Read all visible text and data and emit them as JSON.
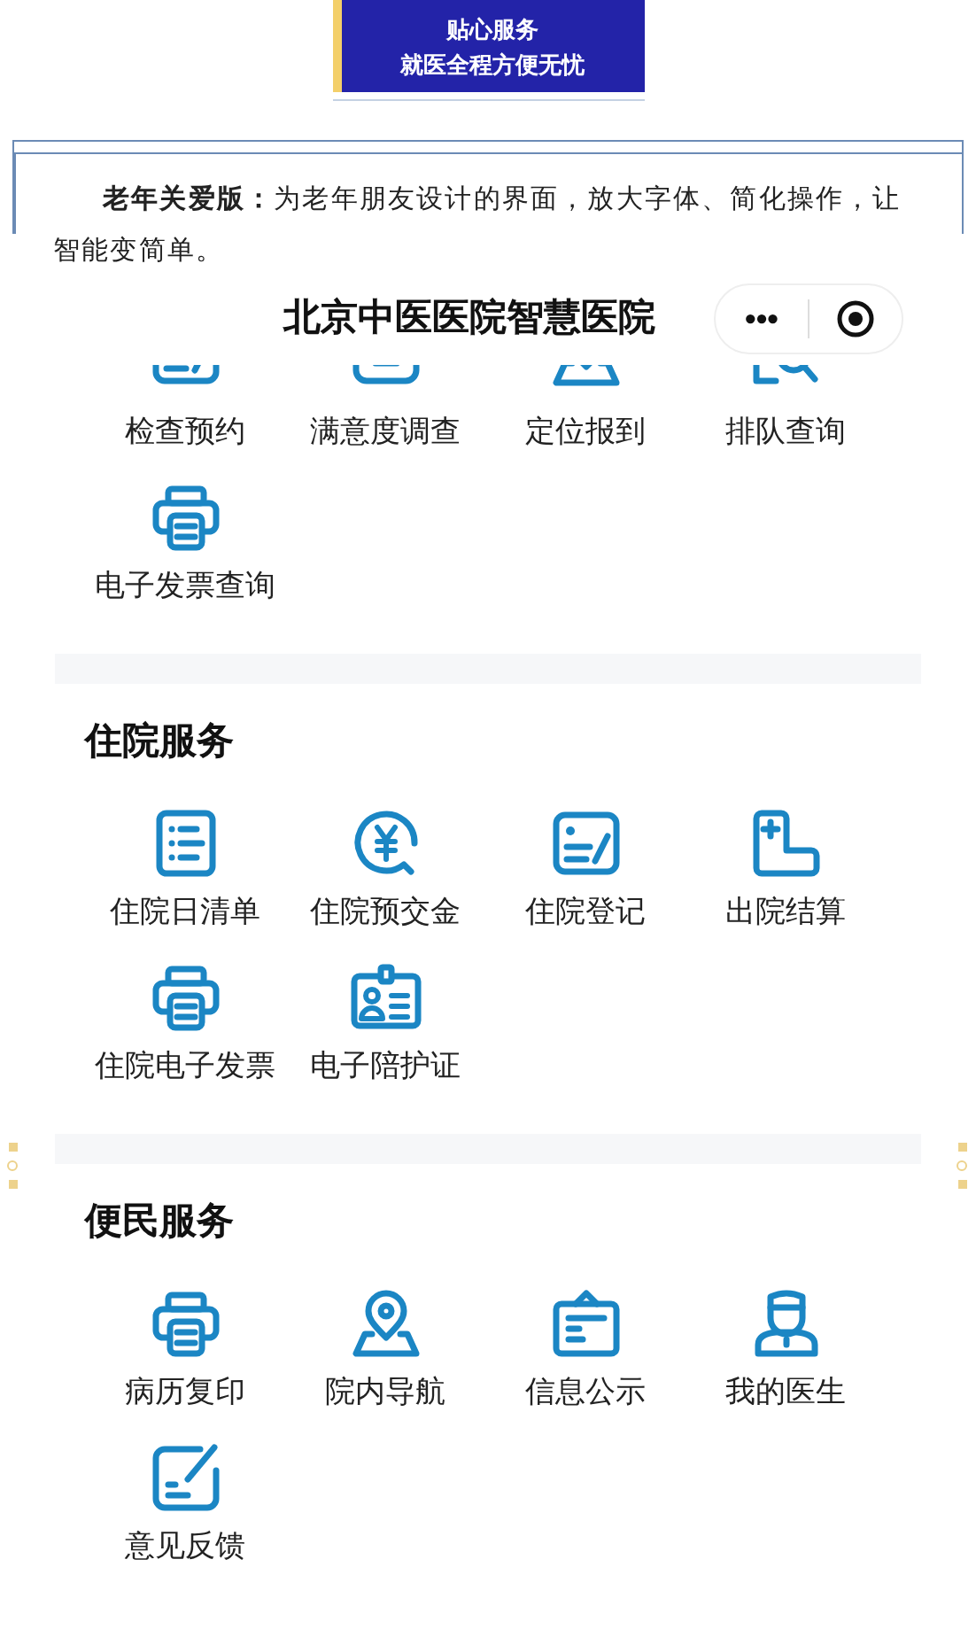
{
  "banner": {
    "lines": [
      "贴心服务",
      "就医全程方便无忧"
    ]
  },
  "intro": {
    "text": "**老年关爱版：**为老年朋友设计的界面，放大字体、简化操作，让智能变简单。"
  },
  "app": {
    "title": "北京中医医院智慧医院",
    "menu_button": "•••"
  },
  "sections": [
    {
      "items": [
        {
          "label": "检查预约",
          "kind": "form",
          "cut": true
        },
        {
          "label": "满意度调查",
          "kind": "tray",
          "cut": true
        },
        {
          "label": "定位报到",
          "kind": "pin",
          "cut": true
        },
        {
          "label": "排队查询",
          "kind": "search",
          "cut": true
        },
        {
          "label": "电子发票查询",
          "kind": "printer",
          "cut": false
        }
      ]
    },
    {
      "title": "住院服务",
      "items": [
        {
          "label": "住院日清单",
          "kind": "list",
          "cut": false
        },
        {
          "label": "住院预交金",
          "kind": "yen",
          "cut": false
        },
        {
          "label": "住院登记",
          "kind": "form",
          "cut": false
        },
        {
          "label": "出院结算",
          "kind": "plus",
          "cut": false
        },
        {
          "label": "住院电子发票",
          "kind": "printer",
          "cut": false
        },
        {
          "label": "电子陪护证",
          "kind": "badge",
          "cut": false
        }
      ]
    },
    {
      "title": "便民服务",
      "items": [
        {
          "label": "病历复印",
          "kind": "printer",
          "cut": false
        },
        {
          "label": "院内导航",
          "kind": "pin",
          "cut": false
        },
        {
          "label": "信息公示",
          "kind": "notice",
          "cut": false
        },
        {
          "label": "我的医生",
          "kind": "doctor",
          "cut": false
        },
        {
          "label": "意见反馈",
          "kind": "edit",
          "cut": false
        }
      ]
    }
  ]
}
